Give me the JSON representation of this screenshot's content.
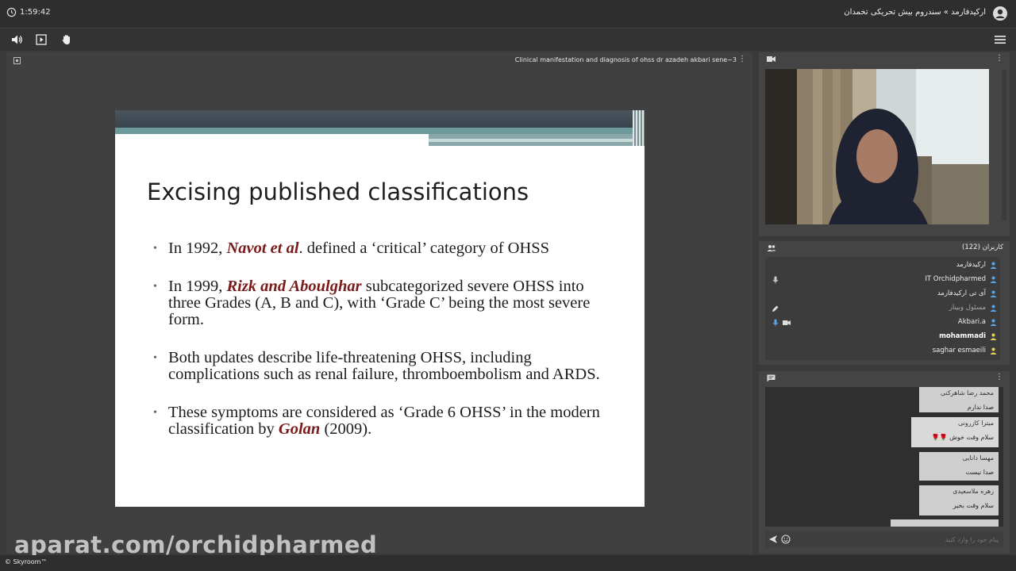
{
  "topbar": {
    "time": "1:59:42",
    "room_title": "ارکیدفارمد » سندروم بیش تحریکی تخمدان"
  },
  "toolbar": {
    "icons": [
      "speaker-icon",
      "screen-share-icon",
      "raise-hand-icon",
      "menu-icon"
    ]
  },
  "document": {
    "name": "Clinical manifestation and diagnosis of ohss dr azadeh akbari sene~3"
  },
  "slide": {
    "title": "Excising published classifications",
    "bullets": [
      {
        "pre": " In 1992, ",
        "hl": "Navot et al",
        "post": ". defined a ‘critical’ category of OHSS"
      },
      {
        "pre": "In 1999, ",
        "hl": "Rizk and Aboulghar",
        "post": " subcategorized severe OHSS into three Grades (A, B and C), with ‘Grade C’ being the most severe form."
      },
      {
        "pre": "Both updates describe life-threatening OHSS, including complications such as renal failure, thromboembolism and ARDS.",
        "hl": "",
        "post": ""
      },
      {
        "pre": " These symptoms are considered as ‘Grade 6 OHSS’ in the modern classification by ",
        "hl": "Golan",
        "post": " (2009)."
      }
    ]
  },
  "users": {
    "title": "کاربران (122)",
    "list": [
      {
        "name": "ارکیدفارمد",
        "style": "normal"
      },
      {
        "name": "IT Orchidpharmed",
        "style": "normal"
      },
      {
        "name": "آی تی ارکیدفارمد",
        "style": "normal"
      },
      {
        "name": "مسئول وبینار",
        "style": "dim"
      },
      {
        "name": "Akbari.a",
        "style": "normal"
      },
      {
        "name": "mohammadi",
        "style": "bold"
      },
      {
        "name": "saghar esmaeili",
        "style": "normal"
      }
    ]
  },
  "chat": {
    "messages": [
      {
        "name": "محمد رضا شاهرکنی",
        "text": "صدا ندارم"
      },
      {
        "name": "میترا کازرونی",
        "text": "سلام وقت خوش 🌹🌹"
      },
      {
        "name": "مهسا دانایی",
        "text": "صدا نیست"
      },
      {
        "name": "زهره ملاسعیدی",
        "text": "سلام وقت بخیر"
      }
    ],
    "input_placeholder": "پیام خود را وارد کنید"
  },
  "watermark": "aparat.com/orchidpharmed",
  "footer": {
    "brand": "© Skyroom™"
  },
  "colors": {
    "highlight": "#7a1a1a",
    "panel": "#444444",
    "background": "#3a3a3a"
  }
}
